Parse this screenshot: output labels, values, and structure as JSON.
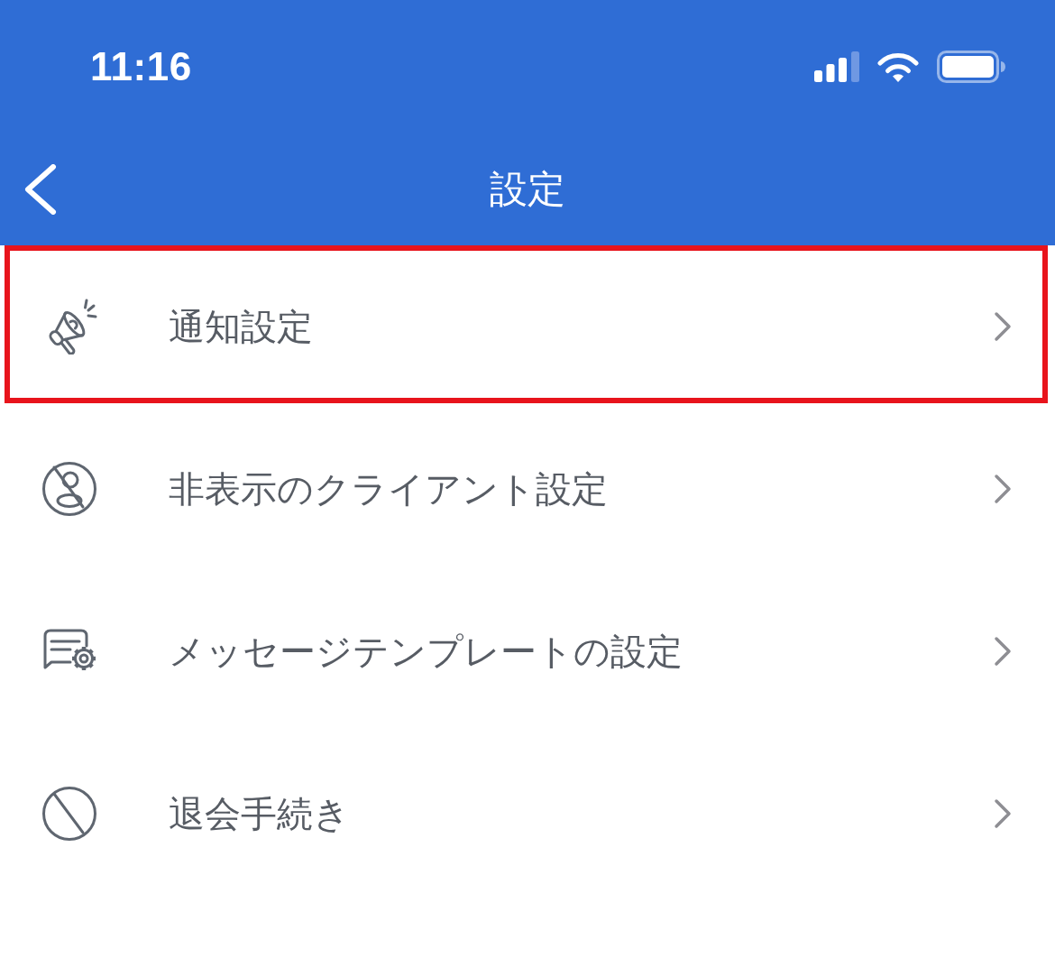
{
  "status_bar": {
    "time": "11:16"
  },
  "nav_bar": {
    "title": "設定"
  },
  "items": [
    {
      "label": "通知設定",
      "highlighted": true
    },
    {
      "label": "非表示のクライアント設定",
      "highlighted": false
    },
    {
      "label": "メッセージテンプレートの設定",
      "highlighted": false
    },
    {
      "label": "退会手続き",
      "highlighted": false
    }
  ]
}
